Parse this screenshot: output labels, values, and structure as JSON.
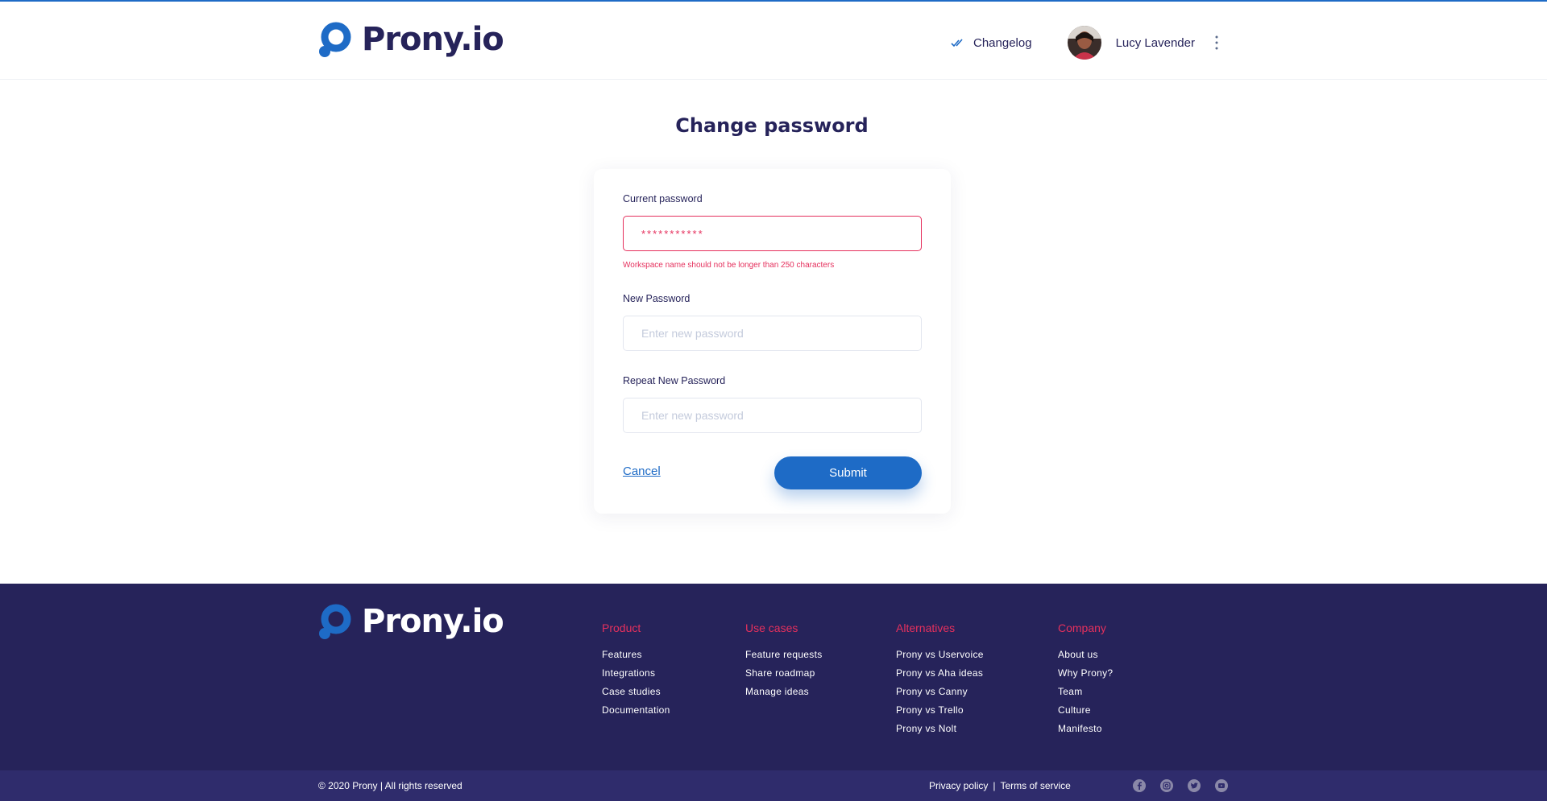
{
  "brand": {
    "name": "Prony.io"
  },
  "header": {
    "changelog_label": "Changelog",
    "user_name": "Lucy Lavender"
  },
  "page": {
    "title": "Change password"
  },
  "form": {
    "current_password": {
      "label": "Current password",
      "value": "***********",
      "error": "Workspace name should not be longer than 250 characters"
    },
    "new_password": {
      "label": "New Password",
      "placeholder": "Enter new password"
    },
    "repeat_password": {
      "label": "Repeat New Password",
      "placeholder": "Enter new password"
    },
    "cancel_label": "Cancel",
    "submit_label": "Submit"
  },
  "footer": {
    "columns": [
      {
        "title": "Product",
        "links": [
          "Features",
          "Integrations",
          "Case studies",
          "Documentation"
        ]
      },
      {
        "title": "Use cases",
        "links": [
          "Feature requests",
          "Share roadmap",
          "Manage ideas"
        ]
      },
      {
        "title": "Alternatives",
        "links": [
          "Prony vs Uservoice",
          "Prony vs Aha ideas",
          "Prony vs Canny",
          "Prony vs Trello",
          "Prony vs Nolt"
        ]
      },
      {
        "title": "Company",
        "links": [
          "About us",
          "Why Prony?",
          "Team",
          "Culture",
          "Manifesto"
        ]
      }
    ],
    "copyright": "© 2020 Prony  |  All rights reserved",
    "privacy_label": "Privacy policy",
    "separator": "|",
    "terms_label": "Terms of service",
    "socials": [
      "facebook-icon",
      "instagram-icon",
      "twitter-icon",
      "youtube-icon"
    ]
  },
  "colors": {
    "primary": "#1e6bc6",
    "navy": "#26235a",
    "error": "#e5305d",
    "bottom_bar": "#2f2c6c"
  }
}
